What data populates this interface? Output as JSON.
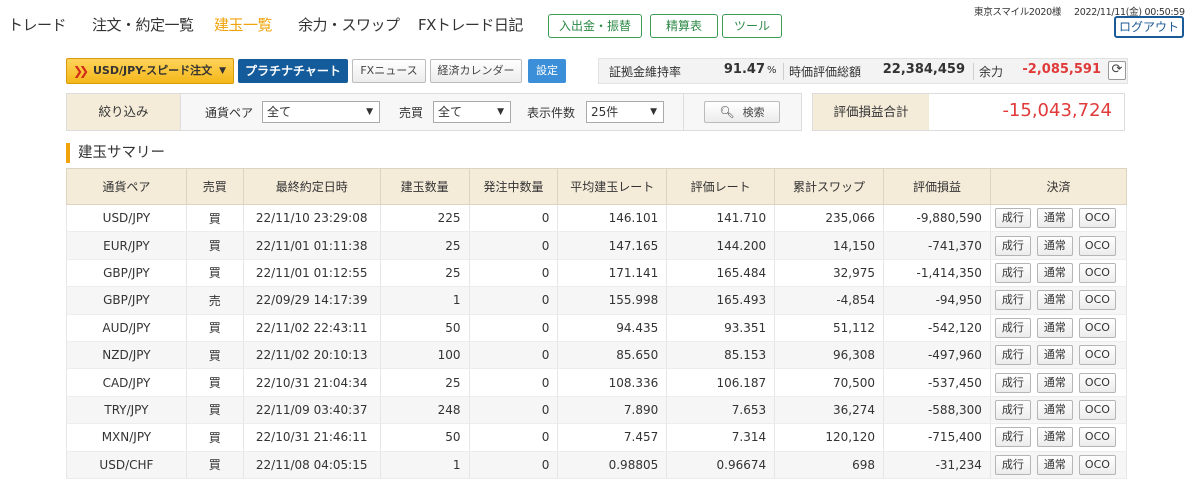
{
  "nav": {
    "items": [
      "トレード",
      "注文・約定一覧",
      "建玉一覧",
      "余力・スワップ",
      "FXトレード日記"
    ],
    "active_index": 2,
    "buttons": [
      "入出金・振替",
      "精算表",
      "ツール"
    ]
  },
  "user": {
    "name": "東京スマイル2020様",
    "datetime": "2022/11/11(金) 00:50:59",
    "logout_label": "ログアウト"
  },
  "toolbar": {
    "speed_order_label": "USD/JPY-スピード注文",
    "platinum_chart_label": "プラチナチャート",
    "fx_news_label": "FXニュース",
    "economic_calendar_label": "経済カレンダー",
    "settings_label": "設定"
  },
  "margin": {
    "ratio_label": "証拠金維持率",
    "ratio_value": "91.47",
    "ratio_unit": "%",
    "valuation_label": "時価評価総額",
    "valuation_value": "22,384,459",
    "available_label": "余力",
    "available_value": "-2,085,591"
  },
  "filter": {
    "title": "絞り込み",
    "pair_label": "通貨ペア",
    "pair_value": "全て",
    "side_label": "売買",
    "side_value": "全て",
    "count_label": "表示件数",
    "count_value": "25件",
    "search_label": "検索"
  },
  "pl_total": {
    "label": "評価損益合計",
    "value": "-15,043,724"
  },
  "section_title": "建玉サマリー",
  "table": {
    "headers": [
      "通貨ペア",
      "売買",
      "最終約定日時",
      "建玉数量",
      "発注中数量",
      "平均建玉レート",
      "評価レート",
      "累計スワップ",
      "評価損益",
      "決済"
    ],
    "action_labels": [
      "成行",
      "通常",
      "OCO"
    ],
    "rows": [
      {
        "pair": "USD/JPY",
        "side": "買",
        "side_type": "buy",
        "datetime": "22/11/10 23:29:08",
        "qty": "225",
        "pending": "0",
        "avg_rate": "146.101",
        "eval_rate": "141.710",
        "swap": "235,066",
        "swap_neg": false,
        "pl": "-9,880,590"
      },
      {
        "pair": "EUR/JPY",
        "side": "買",
        "side_type": "buy",
        "datetime": "22/11/01 01:11:38",
        "qty": "25",
        "pending": "0",
        "avg_rate": "147.165",
        "eval_rate": "144.200",
        "swap": "14,150",
        "swap_neg": false,
        "pl": "-741,370"
      },
      {
        "pair": "GBP/JPY",
        "side": "買",
        "side_type": "buy",
        "datetime": "22/11/01 01:12:55",
        "qty": "25",
        "pending": "0",
        "avg_rate": "171.141",
        "eval_rate": "165.484",
        "swap": "32,975",
        "swap_neg": false,
        "pl": "-1,414,350"
      },
      {
        "pair": "GBP/JPY",
        "side": "売",
        "side_type": "sell",
        "datetime": "22/09/29 14:17:39",
        "qty": "1",
        "pending": "0",
        "avg_rate": "155.998",
        "eval_rate": "165.493",
        "swap": "-4,854",
        "swap_neg": true,
        "pl": "-94,950"
      },
      {
        "pair": "AUD/JPY",
        "side": "買",
        "side_type": "buy",
        "datetime": "22/11/02 22:43:11",
        "qty": "50",
        "pending": "0",
        "avg_rate": "94.435",
        "eval_rate": "93.351",
        "swap": "51,112",
        "swap_neg": false,
        "pl": "-542,120"
      },
      {
        "pair": "NZD/JPY",
        "side": "買",
        "side_type": "buy",
        "datetime": "22/11/02 20:10:13",
        "qty": "100",
        "pending": "0",
        "avg_rate": "85.650",
        "eval_rate": "85.153",
        "swap": "96,308",
        "swap_neg": false,
        "pl": "-497,960"
      },
      {
        "pair": "CAD/JPY",
        "side": "買",
        "side_type": "buy",
        "datetime": "22/10/31 21:04:34",
        "qty": "25",
        "pending": "0",
        "avg_rate": "108.336",
        "eval_rate": "106.187",
        "swap": "70,500",
        "swap_neg": false,
        "pl": "-537,450"
      },
      {
        "pair": "TRY/JPY",
        "side": "買",
        "side_type": "buy",
        "datetime": "22/11/09 03:40:37",
        "qty": "248",
        "pending": "0",
        "avg_rate": "7.890",
        "eval_rate": "7.653",
        "swap": "36,274",
        "swap_neg": false,
        "pl": "-588,300"
      },
      {
        "pair": "MXN/JPY",
        "side": "買",
        "side_type": "buy",
        "datetime": "22/10/31 21:46:11",
        "qty": "50",
        "pending": "0",
        "avg_rate": "7.457",
        "eval_rate": "7.314",
        "swap": "120,120",
        "swap_neg": false,
        "pl": "-715,400"
      },
      {
        "pair": "USD/CHF",
        "side": "買",
        "side_type": "buy",
        "datetime": "22/11/08 04:05:15",
        "qty": "1",
        "pending": "0",
        "avg_rate": "0.98805",
        "eval_rate": "0.96674",
        "swap": "698",
        "swap_neg": false,
        "pl": "-31,234"
      }
    ]
  }
}
